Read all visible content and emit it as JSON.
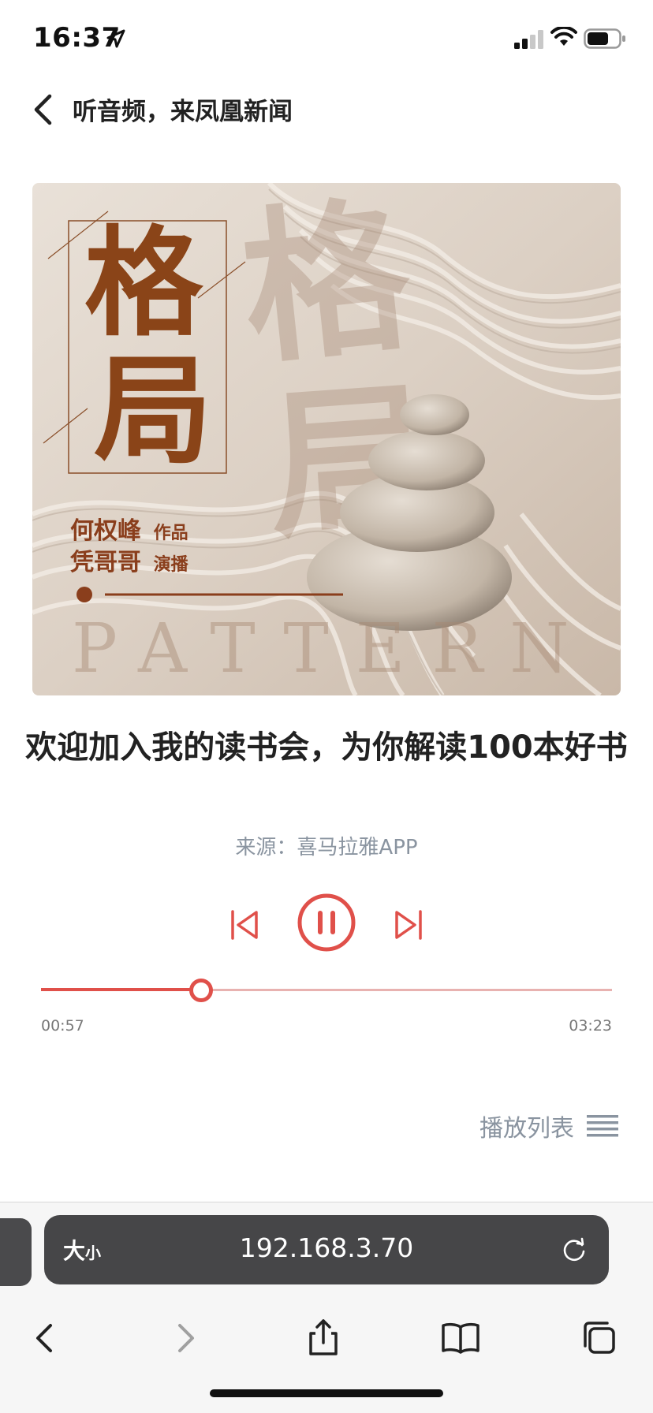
{
  "status_bar": {
    "time": "16:37",
    "icons": [
      "location-arrow-icon",
      "signal-icon",
      "wifi-icon",
      "battery-icon"
    ]
  },
  "header": {
    "title": "听音频，来凤凰新闻",
    "back_icon": "chevron-left-icon"
  },
  "cover": {
    "title_chars": [
      "格",
      "局"
    ],
    "credit_author_name": "何权峰",
    "credit_author_role": "作品",
    "credit_narrator_name": "凭哥哥",
    "credit_narrator_role": "演播",
    "english_word": "PATTERN"
  },
  "track": {
    "title": "欢迎加入我的读书会，为你解读100本好书",
    "source": "来源：喜马拉雅APP"
  },
  "player": {
    "state": "playing",
    "current_time": "00:57",
    "total_time": "03:23",
    "progress_fraction": 0.28,
    "accent_color": "#e0504a"
  },
  "playlist": {
    "label": "播放列表",
    "icon": "list-icon"
  },
  "browser": {
    "text_size_label_big": "大",
    "text_size_label_small": "小",
    "url": "192.168.3.70",
    "toolbar_icons": [
      "back-icon",
      "forward-icon",
      "share-icon",
      "bookmarks-icon",
      "tabs-icon"
    ]
  }
}
